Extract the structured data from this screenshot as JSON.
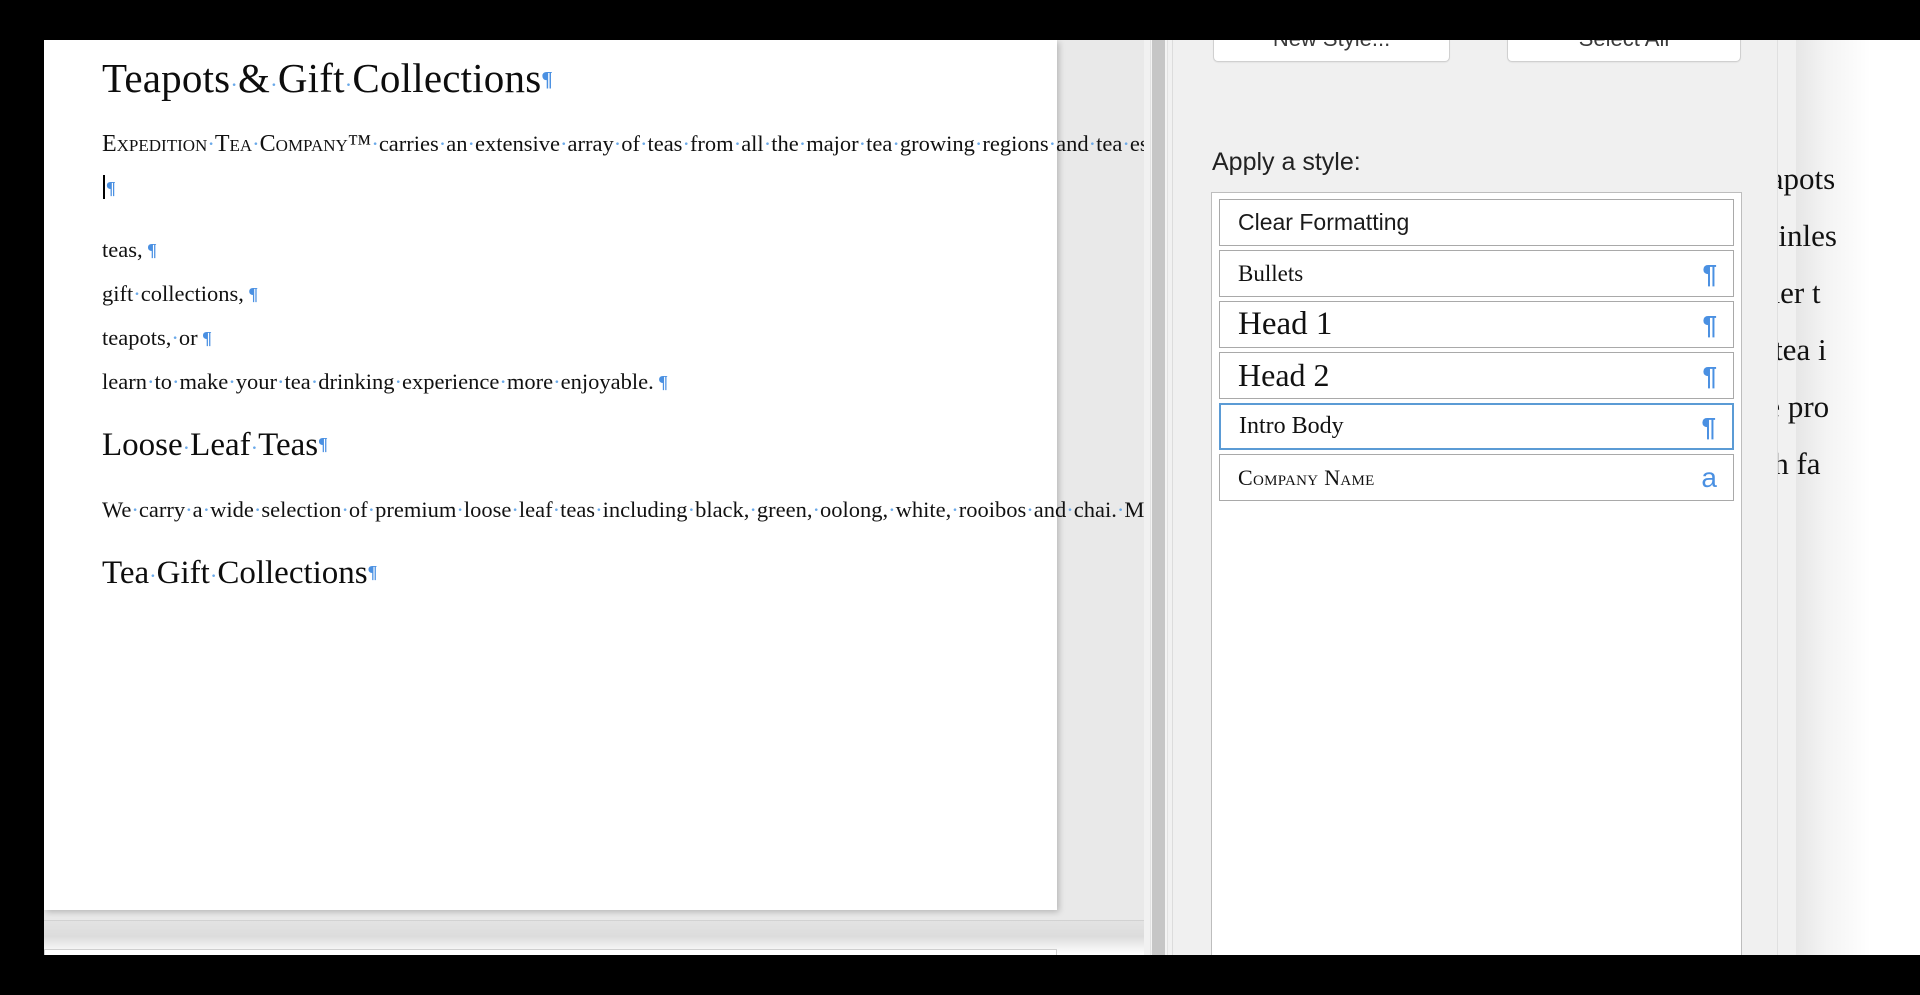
{
  "document": {
    "title": "Teapots & Gift Collections",
    "intro_paragraph": {
      "company": "Expedition Tea Company™",
      "rest": " carries an extensive array of teas from all the major tea growing regions and tea estates. Choose from our selection of"
    },
    "list_lines": [
      "teas,",
      "gift collections,",
      "teapots, or",
      "learn to make your tea drinking experience more enjoyable."
    ],
    "heading_loose_leaf": "Loose Leaf Teas",
    "loose_leaf_paragraph": "We carry a wide selection of premium loose leaf teas including black, green, oolong, white, rooibos and chai. Many of these are from Ethical Tea Partnership monitored estates, ensuring that the tea is produced in socially responsible ways.",
    "heading_tea_gift": "Tea Gift Collections",
    "pilcrow_glyph": "¶",
    "space_dot_glyph": "·"
  },
  "styles_panel": {
    "new_style_button": "New Style...",
    "select_all_button": "Select All",
    "apply_label": "Apply a style:",
    "selection_color": "#5b9bd5",
    "mark_color": "#4a90e2",
    "items": [
      {
        "label": "Clear Formatting",
        "mark": "",
        "selected": false
      },
      {
        "label": "Bullets",
        "mark": "¶",
        "selected": false
      },
      {
        "label": "Head 1",
        "mark": "¶",
        "selected": false
      },
      {
        "label": "Head 2",
        "mark": "¶",
        "selected": false
      },
      {
        "label": "Intro Body",
        "mark": "¶",
        "selected": true
      },
      {
        "label": "Company Name",
        "mark": "a",
        "selected": false
      }
    ]
  },
  "right_document_preview": {
    "lines": [
      "eapots",
      "tainles",
      "ther t",
      "f tea i",
      "re pro",
      "ith fa"
    ]
  }
}
